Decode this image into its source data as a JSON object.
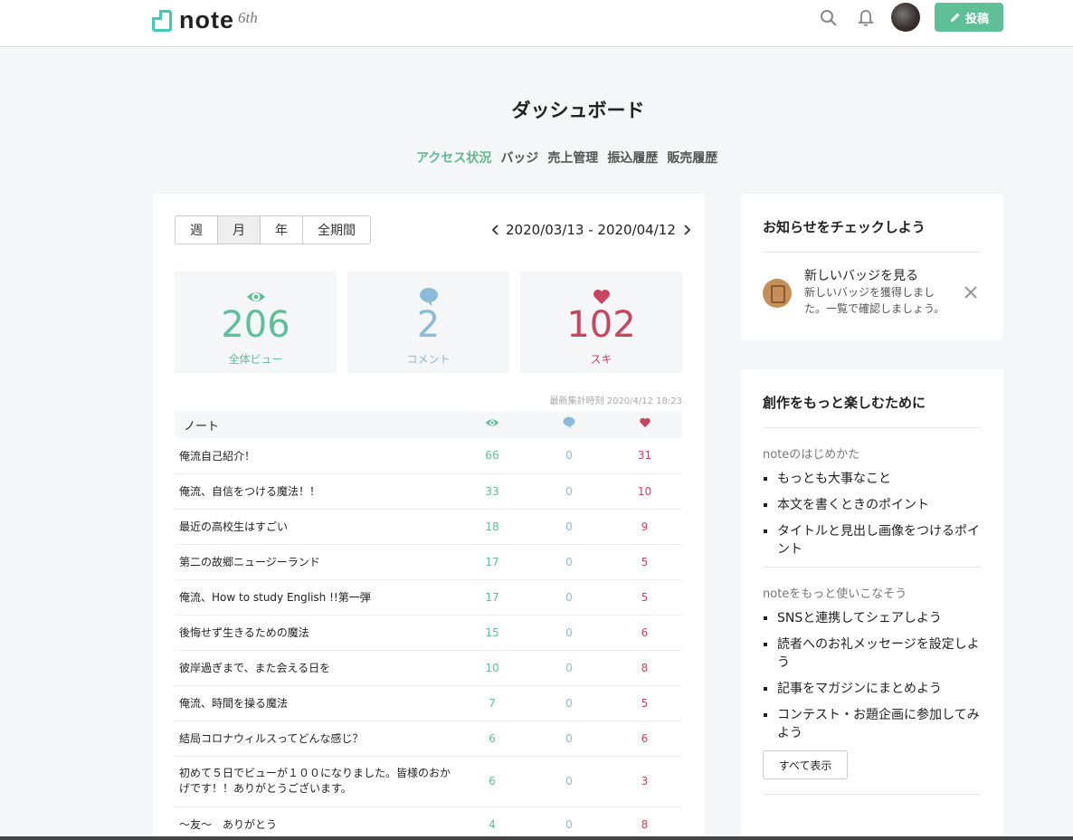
{
  "header": {
    "logo_text": "note",
    "logo_badge": "6th",
    "post_label": "投稿"
  },
  "page": {
    "title": "ダッシュボード",
    "tabs": [
      "アクセス状況",
      "バッジ",
      "売上管理",
      "振込履歴",
      "販売履歴"
    ]
  },
  "period": {
    "options": [
      "週",
      "月",
      "年",
      "全期間"
    ],
    "selected": "月",
    "range": "2020/03/13 - 2020/04/12"
  },
  "stats": {
    "views": {
      "value": "206",
      "label": "全体ビュー",
      "color": "#5fbf98"
    },
    "comments": {
      "value": "2",
      "label": "コメント",
      "color": "#8bbbd9"
    },
    "likes": {
      "value": "102",
      "label": "スキ",
      "color": "#c8455f"
    }
  },
  "updated": "最新集計時刻 2020/4/12 18:23",
  "table": {
    "header": "ノート",
    "rows": [
      {
        "title": "俺流自己紹介！",
        "views": "66",
        "comments": "0",
        "likes": "31"
      },
      {
        "title": "俺流、自信をつける魔法！！",
        "views": "33",
        "comments": "0",
        "likes": "10"
      },
      {
        "title": "最近の高校生はすごい",
        "views": "18",
        "comments": "0",
        "likes": "9"
      },
      {
        "title": "第二の故郷ニュージーランド",
        "views": "17",
        "comments": "0",
        "likes": "5"
      },
      {
        "title": "俺流、How to study English !!第一弾",
        "views": "17",
        "comments": "0",
        "likes": "5"
      },
      {
        "title": "後悔せず生きるための魔法",
        "views": "15",
        "comments": "0",
        "likes": "6"
      },
      {
        "title": "彼岸過ぎまで、また会える日を",
        "views": "10",
        "comments": "0",
        "likes": "8"
      },
      {
        "title": "俺流、時間を操る魔法",
        "views": "7",
        "comments": "0",
        "likes": "5"
      },
      {
        "title": "結局コロナウィルスってどんな感じ？",
        "views": "6",
        "comments": "0",
        "likes": "6"
      },
      {
        "title": "初めて５日でビューが１００になりました。皆様のおかげです！！ありがとうございます。",
        "views": "6",
        "comments": "0",
        "likes": "3"
      },
      {
        "title": "〜友〜　ありがとう",
        "views": "4",
        "comments": "0",
        "likes": "8"
      }
    ]
  },
  "notice": {
    "title": "お知らせをチェックしよう",
    "item_title": "新しいバッジを見る",
    "item_desc_1": "新しいバッジを獲得しまし",
    "item_desc_2": "た。一覧で確認しましょう。"
  },
  "guide": {
    "title": "創作をもっと楽しむために",
    "section1_label": "noteのはじめかた",
    "section1_items": [
      "もっとも大事なこと",
      "本文を書くときのポイント",
      "タイトルと見出し画像をつけるポイント"
    ],
    "section2_label": "noteをもっと使いこなそう",
    "section2_items": [
      "SNSと連携してシェアしよう",
      "読者へのお礼メッセージを設定しよう",
      "記事をマガジンにまとめよう",
      "コンテスト・お題企画に参加してみよう"
    ],
    "show_all": "すべて表示"
  }
}
